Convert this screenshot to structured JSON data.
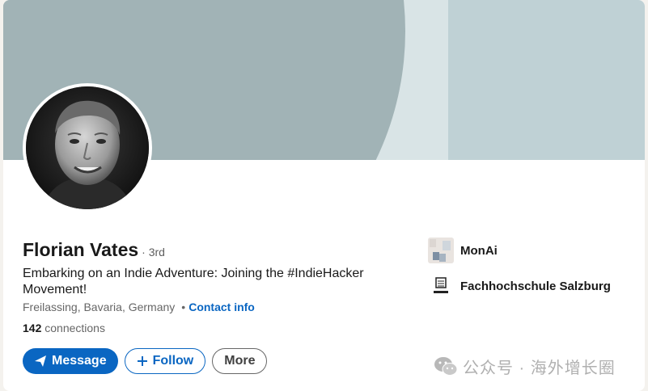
{
  "profile": {
    "name": "Florian Vates",
    "degree": "· 3rd",
    "headline": "Embarking on an Indie Adventure: Joining the #IndieHacker Movement!",
    "location": "Freilassing, Bavaria, Germany",
    "separator": "•",
    "contact_info": "Contact info",
    "connections_count": "142",
    "connections_label": "connections"
  },
  "actions": {
    "message": "Message",
    "follow": "Follow",
    "more": "More"
  },
  "organizations": [
    {
      "name": "MonAi",
      "icon": "company-logo-icon"
    },
    {
      "name": "Fachhochschule Salzburg",
      "icon": "school-logo-icon"
    }
  ],
  "watermark": "公众号 · 海外增长圈",
  "colors": {
    "primary": "#0a66c2",
    "banner_base": "#bfd1d5",
    "banner_circle": "#a1b3b6"
  }
}
